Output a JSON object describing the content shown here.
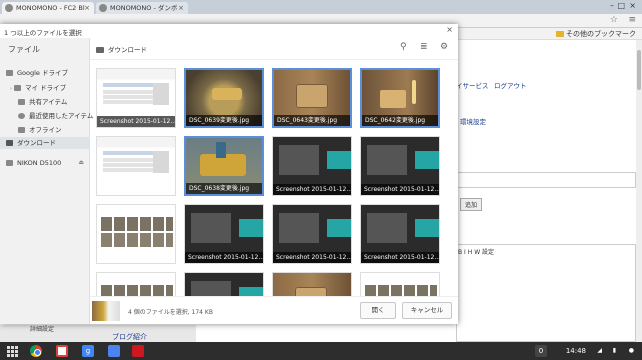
{
  "browser": {
    "tabs": [
      {
        "title": "MONOMONO - FC2 Bl",
        "active": true
      },
      {
        "title": "MONOMONO - ダンボ",
        "active": false
      }
    ],
    "star_icon": "star-icon",
    "menu_icon": "hamburger-menu-icon",
    "bookmarks": {
      "other": "その他のブックマーク"
    }
  },
  "background_page": {
    "links": [
      "イサービス",
      "ログアウト",
      "環境設定"
    ],
    "add_button": "追加",
    "bottom_link": "ブログ紹介",
    "left_label": "詳細設定",
    "editor_buttons": [
      "B",
      "I",
      "H",
      "W",
      "設定"
    ]
  },
  "dialog": {
    "title": "1 つ以上のファイルを選択",
    "close_icon": "close-icon",
    "sidebar": {
      "heading": "ファイル",
      "items": [
        {
          "label": "Google ドライブ",
          "icon": "drive-icon"
        },
        {
          "label": "マイ ドライブ",
          "icon": "folder-icon"
        },
        {
          "label": "共有アイテム",
          "icon": "shared-icon"
        },
        {
          "label": "最近使用したアイテム",
          "icon": "clock-icon"
        },
        {
          "label": "オフライン",
          "icon": "pin-icon"
        },
        {
          "label": "ダウンロード",
          "icon": "download-icon",
          "selected": true
        },
        {
          "label": "NIKON D5100",
          "icon": "device-icon",
          "eject": true
        }
      ]
    },
    "breadcrumb": "ダウンロード",
    "toolbar_icons": [
      "search-icon",
      "list-view-icon",
      "gear-icon"
    ],
    "files": [
      {
        "name": "Screenshot 2015-01-12...",
        "type": "shot",
        "selected": false
      },
      {
        "name": "DSC_0639変更後.jpg",
        "type": "usb",
        "selected": true
      },
      {
        "name": "DSC_0643変更後.jpg",
        "type": "wood",
        "selected": true
      },
      {
        "name": "DSC_0642変更後.jpg",
        "type": "wood2",
        "selected": true
      },
      {
        "name": "",
        "type": "shot",
        "selected": false
      },
      {
        "name": "DSC_0638変更後.jpg",
        "type": "toy",
        "selected": true
      },
      {
        "name": "Screenshot 2015-01-12...",
        "type": "dark",
        "selected": false
      },
      {
        "name": "Screenshot 2015-01-12...",
        "type": "dark",
        "selected": false
      },
      {
        "name": "",
        "type": "grid",
        "selected": false
      },
      {
        "name": "Screenshot 2015-01-12...",
        "type": "dark",
        "selected": false
      },
      {
        "name": "Screenshot 2015-01-12...",
        "type": "dark",
        "selected": false
      },
      {
        "name": "Screenshot 2015-01-12...",
        "type": "dark",
        "selected": false
      },
      {
        "name": "",
        "type": "grid",
        "selected": false
      },
      {
        "name": "",
        "type": "dark",
        "selected": false
      },
      {
        "name": "",
        "type": "wood",
        "selected": false
      },
      {
        "name": "",
        "type": "grid",
        "selected": false
      }
    ],
    "footer": {
      "status": "4 個のファイルを選択, 174 KB",
      "open_label": "開く",
      "cancel_label": "キャンセル"
    }
  },
  "shelf": {
    "apps": [
      "chrome-icon",
      "gmail-icon",
      "google-plus-icon",
      "docs-icon",
      "youtube-icon"
    ],
    "badge": "0",
    "time": "14:48"
  }
}
